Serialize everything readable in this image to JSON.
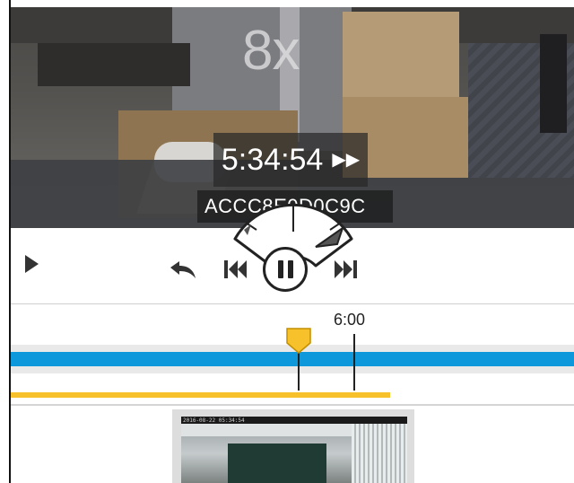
{
  "player": {
    "speed_label": "8x",
    "time": "5:34:54",
    "fast_forward_glyph": "▶▶",
    "camera_id": "ACCC8E0D0C9C"
  },
  "controls": {
    "play_icon": "play-icon",
    "undo_icon": "undo-icon",
    "previous_icon": "skip-previous-icon",
    "pause_icon": "pause-icon",
    "next_icon": "skip-next-icon",
    "speed_dial_icon": "speed-dial-icon"
  },
  "timeline": {
    "tick_label": "6:00",
    "colors": {
      "recording_bar": "#0e98dc",
      "event_bar": "#f6c12b",
      "marker": "#f6c12b"
    }
  },
  "thumbnail": {
    "timestamp": "2016-08-22 05:34:54"
  }
}
